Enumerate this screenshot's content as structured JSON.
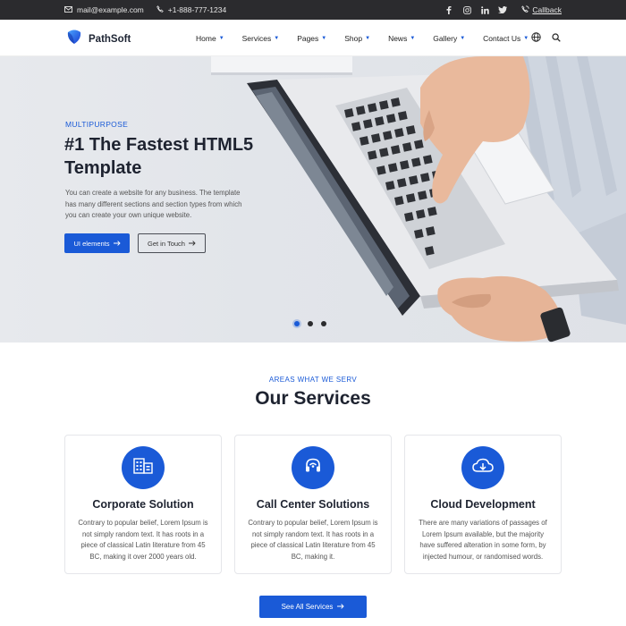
{
  "topbar": {
    "email": "mail@example.com",
    "phone": "+1-888-777-1234",
    "callback_label": "Callback",
    "socials": [
      "facebook-icon",
      "instagram-icon",
      "linkedin-icon",
      "twitter-icon"
    ]
  },
  "header": {
    "brand": "PathSoft",
    "nav": [
      {
        "label": "Home"
      },
      {
        "label": "Services"
      },
      {
        "label": "Pages"
      },
      {
        "label": "Shop"
      },
      {
        "label": "News"
      },
      {
        "label": "Gallery"
      },
      {
        "label": "Contact Us"
      }
    ]
  },
  "hero": {
    "eyebrow": "MULTIPURPOSE",
    "title": "#1 The Fastest HTML5 Template",
    "description": "You can create a website for any business. The template has many different sections and section types from which you can create your own unique website.",
    "primary_button": "UI elements",
    "secondary_button": "Get in Touch",
    "slides": 3,
    "active_slide": 1
  },
  "services": {
    "eyebrow": "AREAS WHAT WE SERV",
    "title": "Our Services",
    "cards": [
      {
        "icon": "building-icon",
        "title": "Corporate Solution",
        "text": "Contrary to popular belief, Lorem Ipsum is not simply random text. It has roots in a piece of classical Latin literature from 45 BC, making it over 2000 years old."
      },
      {
        "icon": "headset-icon",
        "title": "Call Center Solutions",
        "text": "Contrary to popular belief, Lorem Ipsum is not simply random text. It has roots in a piece of classical Latin literature from 45 BC, making it."
      },
      {
        "icon": "cloud-download-icon",
        "title": "Cloud Development",
        "text": "There are many variations of passages of Lorem Ipsum available, but the majority have suffered alteration in some form, by injected humour, or randomised words."
      }
    ],
    "see_all_button": "See All Services"
  },
  "colors": {
    "accent": "#1a5ad7",
    "topbar": "#2b2b2e",
    "heading": "#1e2330"
  }
}
